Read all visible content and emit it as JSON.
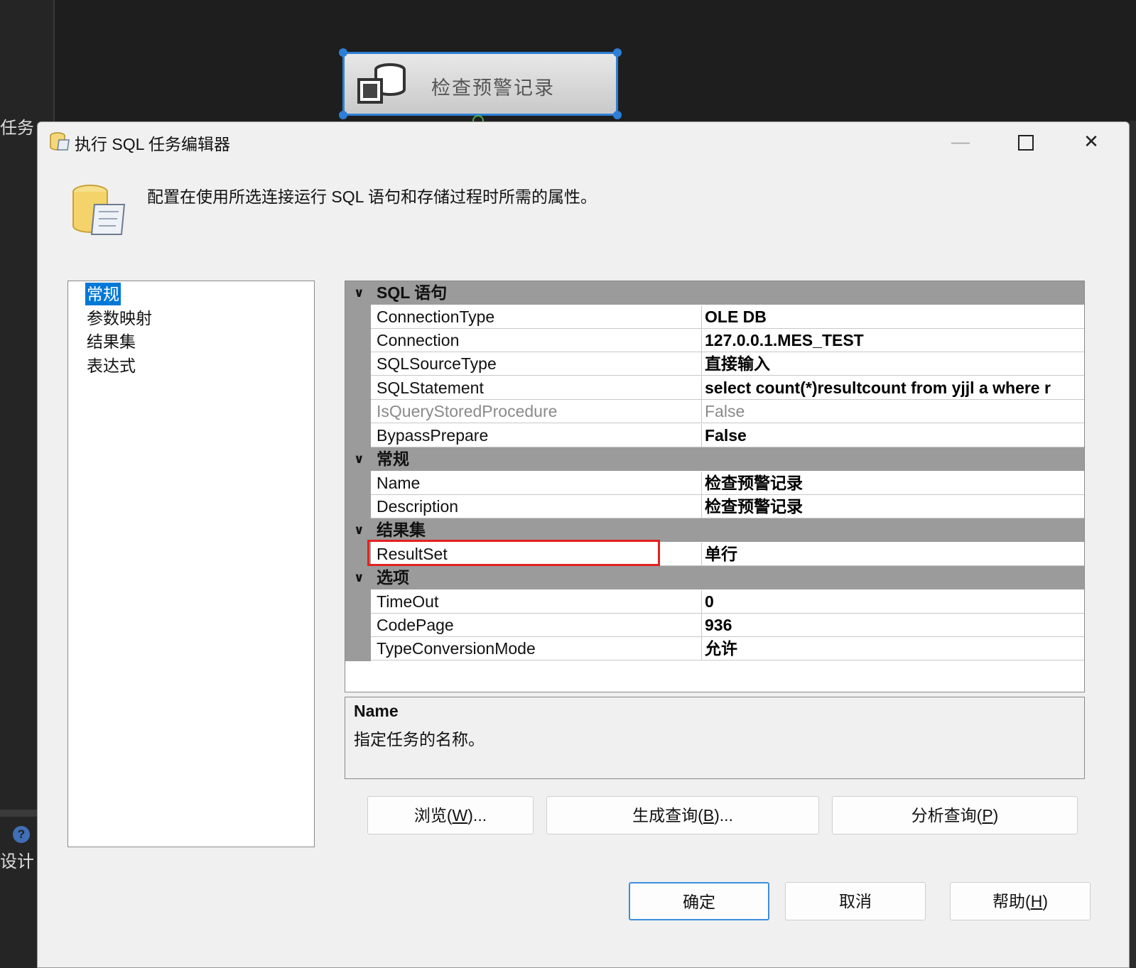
{
  "background": {
    "left_label_top": "任务",
    "left_label_bottom": "设计",
    "help_glyph": "?",
    "task_label": "检查预警记录",
    "task_icon": "sql-task-icon"
  },
  "dialog": {
    "title": "执行 SQL 任务编辑器",
    "title_icon": "sql-scroll-icon",
    "window_buttons": {
      "minimize": "—",
      "maximize": "□",
      "close": "✕"
    },
    "header_text": "配置在使用所选连接运行 SQL 语句和存储过程时所需的属性。",
    "header_icon": "database-scroll-icon"
  },
  "nav": {
    "items": [
      {
        "label": "常规",
        "selected": true
      },
      {
        "label": "参数映射"
      },
      {
        "label": "结果集"
      },
      {
        "label": "表达式"
      }
    ]
  },
  "grid": {
    "categories": [
      {
        "label": "SQL 语句",
        "props": [
          {
            "name": "ConnectionType",
            "value": "OLE DB"
          },
          {
            "name": "Connection",
            "value": "127.0.0.1.MES_TEST"
          },
          {
            "name": "SQLSourceType",
            "value": "直接输入"
          },
          {
            "name": "SQLStatement",
            "value": "select count(*)resultcount  from yjjl a where r"
          },
          {
            "name": "IsQueryStoredProcedure",
            "value": "False",
            "disabled": true
          },
          {
            "name": "BypassPrepare",
            "value": "False"
          }
        ]
      },
      {
        "label": "常规",
        "props": [
          {
            "name": "Name",
            "value": "检查预警记录"
          },
          {
            "name": "Description",
            "value": "检查预警记录"
          }
        ]
      },
      {
        "label": "结果集",
        "props": [
          {
            "name": "ResultSet",
            "value": "单行"
          }
        ]
      },
      {
        "label": "选项",
        "props": [
          {
            "name": "TimeOut",
            "value": "0"
          },
          {
            "name": "CodePage",
            "value": "936"
          },
          {
            "name": "TypeConversionMode",
            "value": "允许"
          }
        ]
      }
    ],
    "highlight_color": "#e32020"
  },
  "description": {
    "title": "Name",
    "body": "指定任务的名称。"
  },
  "buttons": {
    "browse": {
      "pre": "浏览(",
      "key": "W",
      "post": ")..."
    },
    "build_query": {
      "pre": "生成查询(",
      "key": "B",
      "post": ")..."
    },
    "parse_query": {
      "pre": "分析查询(",
      "key": "P",
      "post": ")"
    },
    "ok": "确定",
    "cancel": "取消",
    "help": {
      "pre": "帮助(",
      "key": "H",
      "post": ")"
    }
  },
  "colors": {
    "accent": "#0078d7",
    "category_bg": "#9b9b9b",
    "selection_border": "#2d7fd6"
  }
}
